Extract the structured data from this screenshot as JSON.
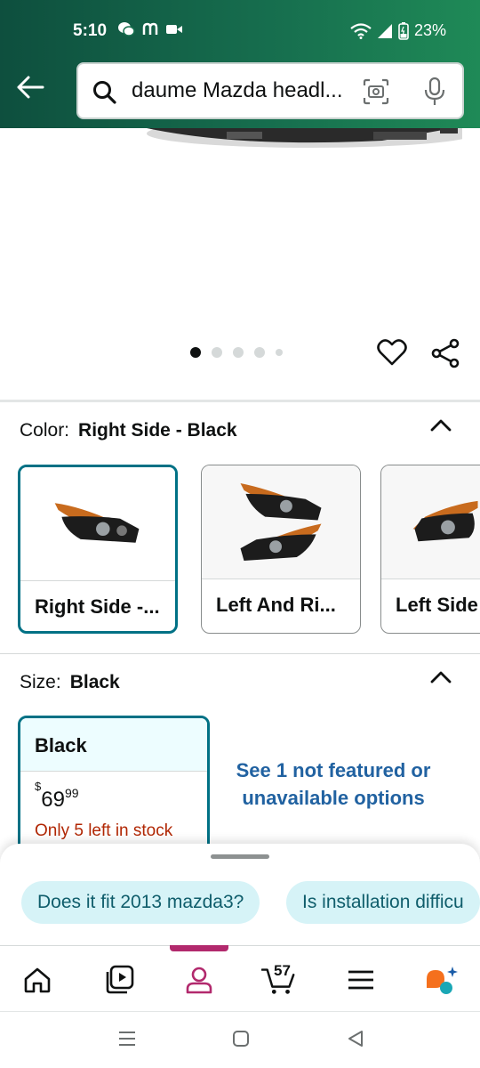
{
  "status_bar": {
    "time": "5:10",
    "battery": "23%",
    "icons": [
      "wechat-icon",
      "app-icon",
      "video-icon",
      "wifi-icon",
      "signal-icon",
      "battery-icon"
    ]
  },
  "search": {
    "query": "daume Mazda headl..."
  },
  "gallery": {
    "dot_count": 5,
    "active_index": 0
  },
  "color": {
    "label": "Color:",
    "selected": "Right Side - Black",
    "options": [
      "Right Side -...",
      "Left And Ri...",
      "Left Side"
    ]
  },
  "size": {
    "label": "Size:",
    "selected": "Black",
    "card": {
      "name": "Black",
      "currency": "$",
      "dollars": "69",
      "cents": "99",
      "stock": "Only 5 left in stock"
    },
    "unavailable_link": "See 1 not featured or unavailable options"
  },
  "questions": [
    "Does it fit 2013 mazda3?",
    "Is installation difficu"
  ],
  "bottom_nav": {
    "items": [
      "home-icon",
      "video-icon",
      "account-icon",
      "cart-icon",
      "menu-icon",
      "rufus-icon"
    ],
    "cart_count": "57",
    "active": "account-icon"
  },
  "colors": {
    "header_start": "#0e4f3e",
    "header_end": "#1f8a57",
    "selected_border": "#007185",
    "link": "#2162a1",
    "stock_red": "#b12704",
    "chip_bg": "#d6f3f7",
    "nav_active": "#b2296d"
  }
}
